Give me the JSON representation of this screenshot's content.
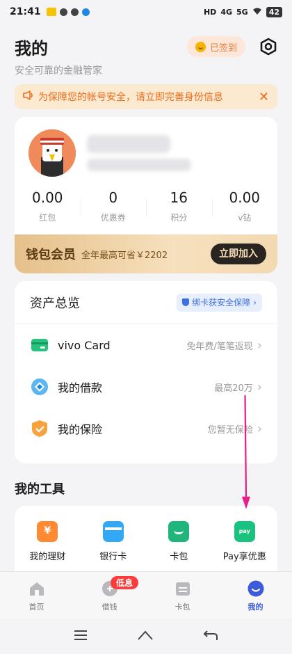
{
  "status_bar": {
    "time": "21:41",
    "signal_1": "4G",
    "signal_2": "5G",
    "battery": "42",
    "hd": "HD"
  },
  "header": {
    "title": "我的",
    "subtitle": "安全可靠的金融管家",
    "signin_label": "已签到"
  },
  "notice": {
    "text": "为保障您的帐号安全，请立即完善身份信息"
  },
  "profile": {
    "stats": [
      {
        "value": "0.00",
        "label": "红包"
      },
      {
        "value": "0",
        "label": "优惠券"
      },
      {
        "value": "16",
        "label": "积分"
      },
      {
        "value": "0.00",
        "label": "v钻"
      }
    ]
  },
  "vip": {
    "title": "钱包会员",
    "desc": "全年最高可省￥2202",
    "button": "立即加入"
  },
  "assets": {
    "title": "资产总览",
    "bind_label": "绑卡获安全保障",
    "rows": [
      {
        "name": "vivo Card",
        "hint": "免年费/笔笔返现",
        "icon": "card-icon"
      },
      {
        "name": "我的借款",
        "hint": "最高20万",
        "icon": "loan-icon"
      },
      {
        "name": "我的保险",
        "hint": "您暂无保险",
        "icon": "insurance-icon"
      }
    ]
  },
  "tools": {
    "title": "我的工具",
    "items": [
      {
        "label": "我的理财",
        "icon": "wealth-icon"
      },
      {
        "label": "银行卡",
        "icon": "bank-card-icon"
      },
      {
        "label": "卡包",
        "icon": "card-wallet-icon"
      },
      {
        "label": "Pay享优惠",
        "icon": "pay-icon"
      }
    ]
  },
  "tabbar": {
    "items": [
      {
        "label": "首页"
      },
      {
        "label": "借钱",
        "badge": "低息"
      },
      {
        "label": "卡包"
      },
      {
        "label": "我的"
      }
    ]
  },
  "colors": {
    "accent": "#3b5bdb",
    "warning": "#ef6c1a",
    "vip_gold": "#e6c08a",
    "annotation_arrow": "#e91e8c"
  }
}
